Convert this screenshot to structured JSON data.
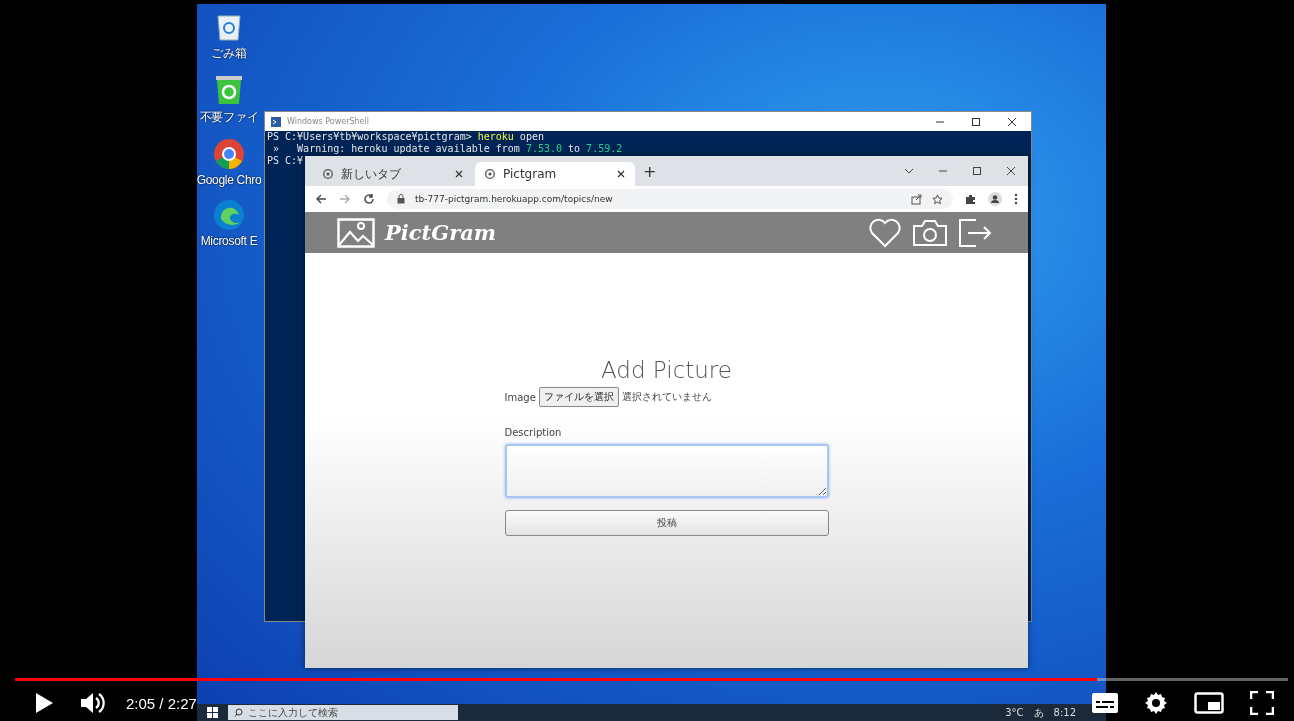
{
  "desktop": {
    "icons": [
      {
        "kind": "trash",
        "label": "ごみ箱"
      },
      {
        "kind": "recycle",
        "label": "不要ファイ"
      },
      {
        "kind": "chrome",
        "label": "Google Chro"
      },
      {
        "kind": "edge",
        "label": "Microsoft E"
      }
    ]
  },
  "powershell": {
    "title": "Windows PowerShell",
    "lines": [
      [
        {
          "kind": "plain",
          "text": "PS C:¥Users¥tb¥workspace¥pictgram> "
        },
        {
          "kind": "command",
          "text": "heroku"
        },
        {
          "kind": "plain",
          "text": " open"
        }
      ],
      [
        {
          "kind": "plain",
          "text": " »   Warning: heroku update available from "
        },
        {
          "kind": "number",
          "text": "7.53.0"
        },
        {
          "kind": "plain",
          "text": " to "
        },
        {
          "kind": "number",
          "text": "7.59.2"
        }
      ],
      [
        {
          "kind": "plain",
          "text": "PS C:¥"
        }
      ]
    ]
  },
  "browser": {
    "tabs": [
      {
        "title": "新しいタブ",
        "selected": false
      },
      {
        "title": "Pictgram",
        "selected": true
      }
    ],
    "new_tab": "+",
    "url": "tb-777-pictgram.herokuapp.com/topics/new",
    "site": {
      "logo": "PictGram",
      "heading": "Add Picture",
      "image_label": "Image",
      "file_button": "ファイルを選択",
      "file_status": "選択されていません",
      "description_label": "Description",
      "description_focused": true,
      "submit": "投稿"
    }
  },
  "taskbar": {
    "search_placeholder": "ここに入力して検索",
    "temperature": "3°C",
    "ime": "あ",
    "clock": "8:12"
  },
  "player": {
    "progress": {
      "level": 0.85
    },
    "time": "2:05 / 2:27"
  }
}
